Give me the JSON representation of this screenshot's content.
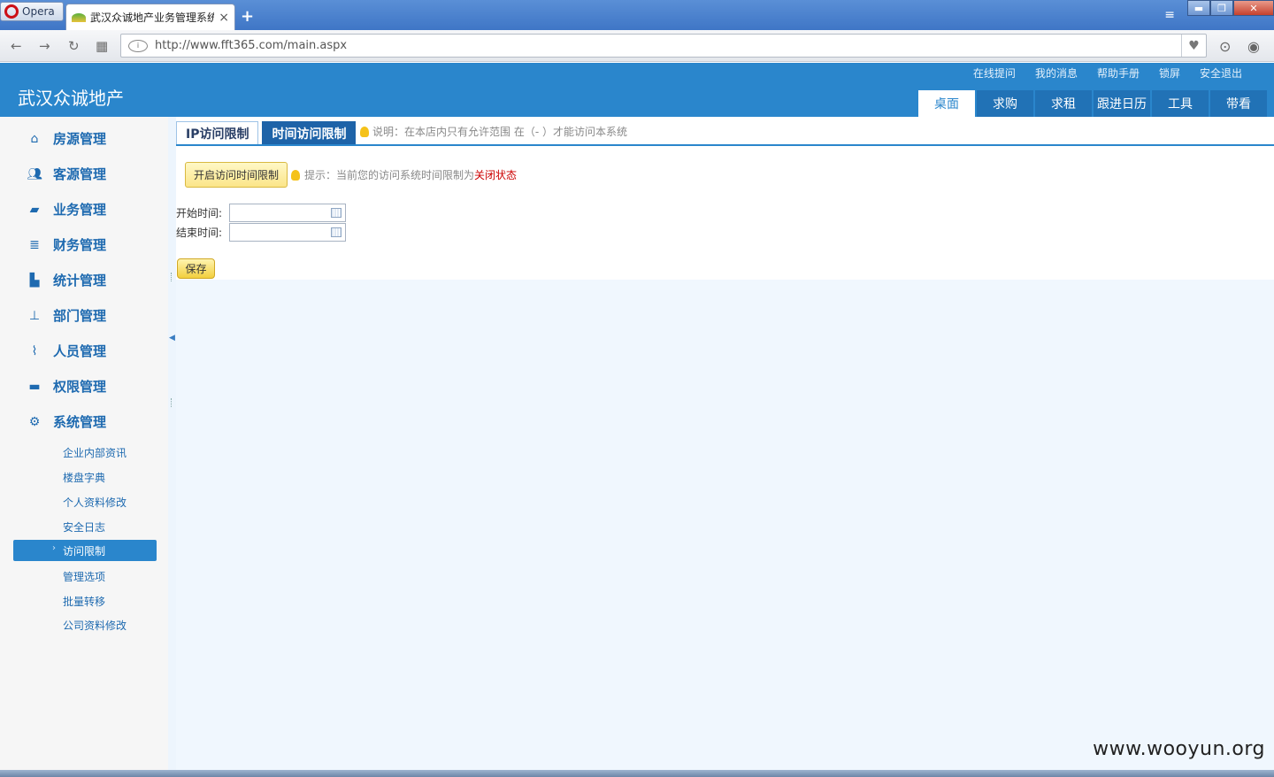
{
  "browser": {
    "menu_label": "Opera",
    "tab_title": "武汉众诚地产业务管理系统",
    "tab_close": "×",
    "new_tab": "+",
    "url": "http://www.fft365.com/main.aspx"
  },
  "header": {
    "logo": "武汉众诚地产",
    "top_links": [
      "在线提问",
      "我的消息",
      "帮助手册",
      "锁屏",
      "安全退出"
    ],
    "nav_tabs": [
      "桌面",
      "求购",
      "求租",
      "跟进日历",
      "工具",
      "带看"
    ],
    "active_nav": "桌面"
  },
  "sidebar": {
    "menu": [
      {
        "label": "房源管理",
        "icon": "home-icon"
      },
      {
        "label": "客源管理",
        "icon": "users-icon"
      },
      {
        "label": "业务管理",
        "icon": "car-icon"
      },
      {
        "label": "财务管理",
        "icon": "finance-icon"
      },
      {
        "label": "统计管理",
        "icon": "bar-chart-icon"
      },
      {
        "label": "部门管理",
        "icon": "org-chart-icon"
      },
      {
        "label": "人员管理",
        "icon": "paperclip-icon"
      },
      {
        "label": "权限管理",
        "icon": "chat-icon"
      },
      {
        "label": "系统管理",
        "icon": "gear-icon"
      }
    ],
    "sub_items": [
      "企业内部资讯",
      "楼盘字典",
      "个人资料修改",
      "安全日志",
      "访问限制",
      "管理选项",
      "批量转移",
      "公司资料修改"
    ],
    "active_sub": "访问限制"
  },
  "content": {
    "tabs": [
      "IP访问限制",
      "时间访问限制"
    ],
    "active_tab": "时间访问限制",
    "tab_note": "说明：在本店内只有允许范围 在（- ）才能访问本系统",
    "open_button": "开启访问时间限制",
    "hint_prefix": "提示：当前您的访问系统时间限制为",
    "hint_state": "关闭状态",
    "start_label": "开始时间:",
    "start_value": "",
    "end_label": "结束时间:",
    "end_value": "",
    "save_button": "保存"
  },
  "watermark": "www.wooyun.org",
  "colors": {
    "header_blue": "#2a86cc",
    "nav_tab_blue": "#2172b6",
    "menu_text": "#1e6ab0",
    "active_subtab": "#1e63a8",
    "hint_state_red": "#cc0000",
    "content_bg": "#f0f7fe"
  }
}
